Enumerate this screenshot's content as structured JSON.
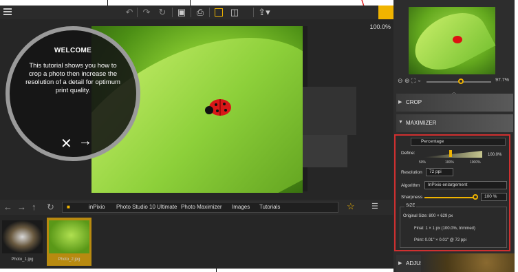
{
  "toolbar": {
    "icons": [
      "undo-icon",
      "redo-icon",
      "rotate-icon",
      "save-icon",
      "print-icon",
      "single-view-icon",
      "compare-view-icon",
      "share-icon"
    ]
  },
  "editor": {
    "zoom_label": "100.0%"
  },
  "welcome": {
    "title": "WELCOME",
    "body": "This tutorial shows you how to crop a photo then increase the resolution of a detail for optimum print quality."
  },
  "breadcrumb": [
    "inPixio",
    "Photo Studio 10 Ultimate",
    "Photo Maximizer",
    "Images",
    "Tutorials"
  ],
  "filmstrip": [
    {
      "label": "Photo_1.jpg",
      "selected": false
    },
    {
      "label": "Photo_2.jpg",
      "selected": true
    }
  ],
  "panel": {
    "zoom_value": "97.7%",
    "sections": {
      "crop": "CROP",
      "maximizer": "MAXIMIZER",
      "adjustments": "ADJUSTMENTS"
    },
    "maximizer": {
      "mode": "Percentage",
      "define_label": "Define:",
      "define_value": "100.0%",
      "define_ticks": [
        "50%",
        "100%",
        "1000%"
      ],
      "resolution_label": "Resolution",
      "resolution_value": "72 ppi",
      "algorithm_label": "Algorithm",
      "algorithm_value": "InPixio enlargement",
      "sharpness_label": "Sharpness",
      "sharpness_value": "100 %",
      "size_title": "SIZE",
      "original_size": "Original Size:  800 × 629 px",
      "final_size": "Final:  1 × 1 px (100.0%, trimmed)",
      "print_size": "Print:  0.01\" × 0.01\" @ 72 ppi"
    }
  },
  "colors": {
    "accent": "#f0b400",
    "highlight_border": "#d03030"
  }
}
